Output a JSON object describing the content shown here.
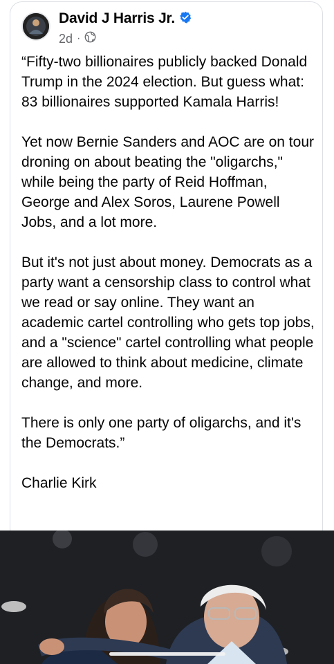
{
  "post": {
    "author": "David J Harris Jr.",
    "time": "2d",
    "separator": "·",
    "icons": {
      "verified": "verified-badge-icon",
      "audience": "globe-icon"
    },
    "colors": {
      "verified": "#1877F2",
      "meta": "#65676b",
      "text": "#050505"
    },
    "paragraphs": [
      "“Fifty-two billionaires publicly backed Donald Trump in the 2024 election. But guess what: 83 billionaires supported Kamala Harris!",
      "Yet now Bernie Sanders and AOC are on tour droning on about beating the \"oligarchs,\" while being the party of Reid Hoffman, George and Alex Soros, Laurene Powell Jobs, and a lot more.",
      "But it's not just about money. Democrats as a party want a censorship class to control what we read or say online. They want an academic cartel controlling who gets top jobs, and a \"science\" cartel controlling what people are allowed to think about medicine, climate change, and more.",
      "There is only one party of oligarchs, and it's the Democrats.”"
    ],
    "signature": "Charlie Kirk"
  }
}
